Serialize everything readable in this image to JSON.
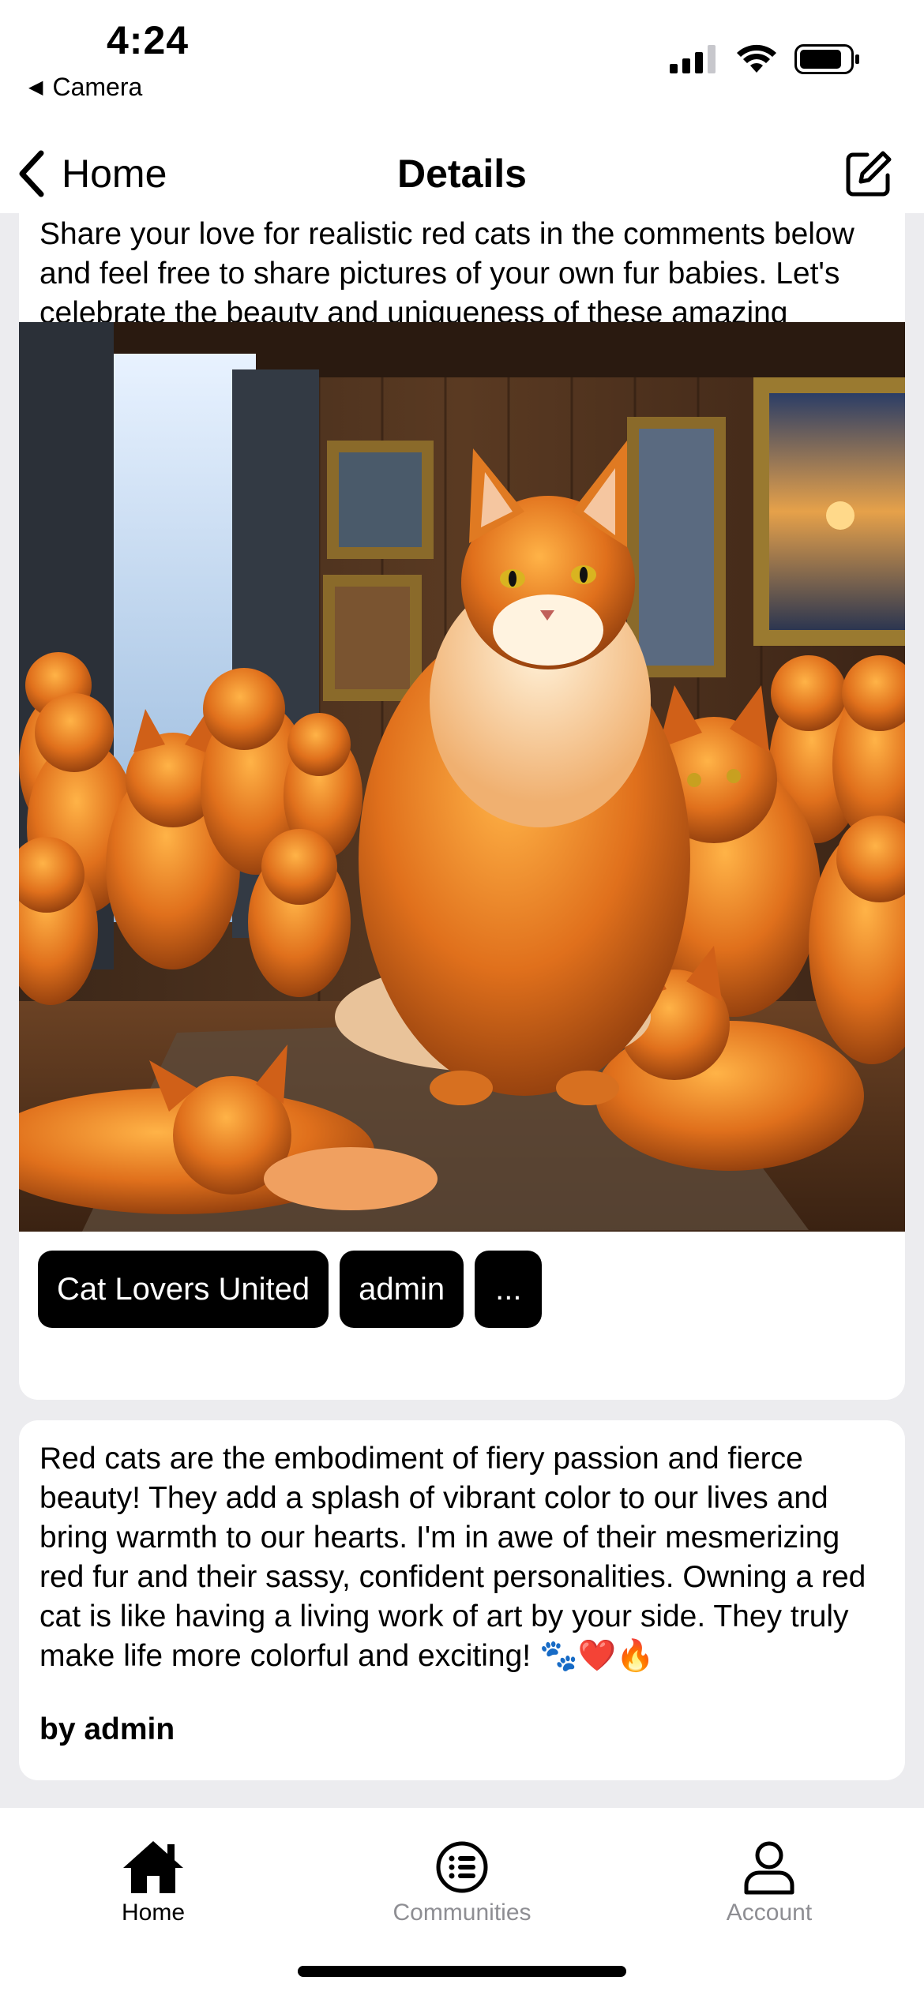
{
  "status_bar": {
    "time": "4:24",
    "back_app": "Camera",
    "icons": [
      "cellular-signal-icon",
      "wifi-icon",
      "battery-icon"
    ]
  },
  "nav": {
    "back_label": "Home",
    "title": "Details",
    "compose_icon": "compose-icon"
  },
  "post": {
    "text": "Share your love for realistic red cats in the comments below and feel free to share pictures of your own fur babies. Let's celebrate the beauty and uniqueness of these amazing creatures together!",
    "image": "illustration of many fluffy red cats in a wood-paneled room",
    "tags": {
      "community": "Cat Lovers United",
      "author": "admin",
      "more": "..."
    }
  },
  "comment": {
    "text": "Red cats are the embodiment of fiery passion and fierce beauty! They add a splash of vibrant color to our lives and bring warmth to our hearts. I'm in awe of their mesmerizing red fur and their sassy, confident personalities. Owning a red cat is like having a living work of art by your side. They truly make life more colorful and exciting! 🐾❤️🔥",
    "author_line": "by admin"
  },
  "tab_bar": {
    "tabs": [
      {
        "label": "Home",
        "icon": "house-icon",
        "active": true
      },
      {
        "label": "Communities",
        "icon": "list-circle-icon",
        "active": false
      },
      {
        "label": "Account",
        "icon": "person-icon",
        "active": false
      }
    ]
  },
  "colors": {
    "background": "#ececef",
    "card": "#ffffff",
    "tag_bg": "#000000",
    "tag_text": "#ffffff",
    "inactive_tab": "#8e8e93"
  }
}
